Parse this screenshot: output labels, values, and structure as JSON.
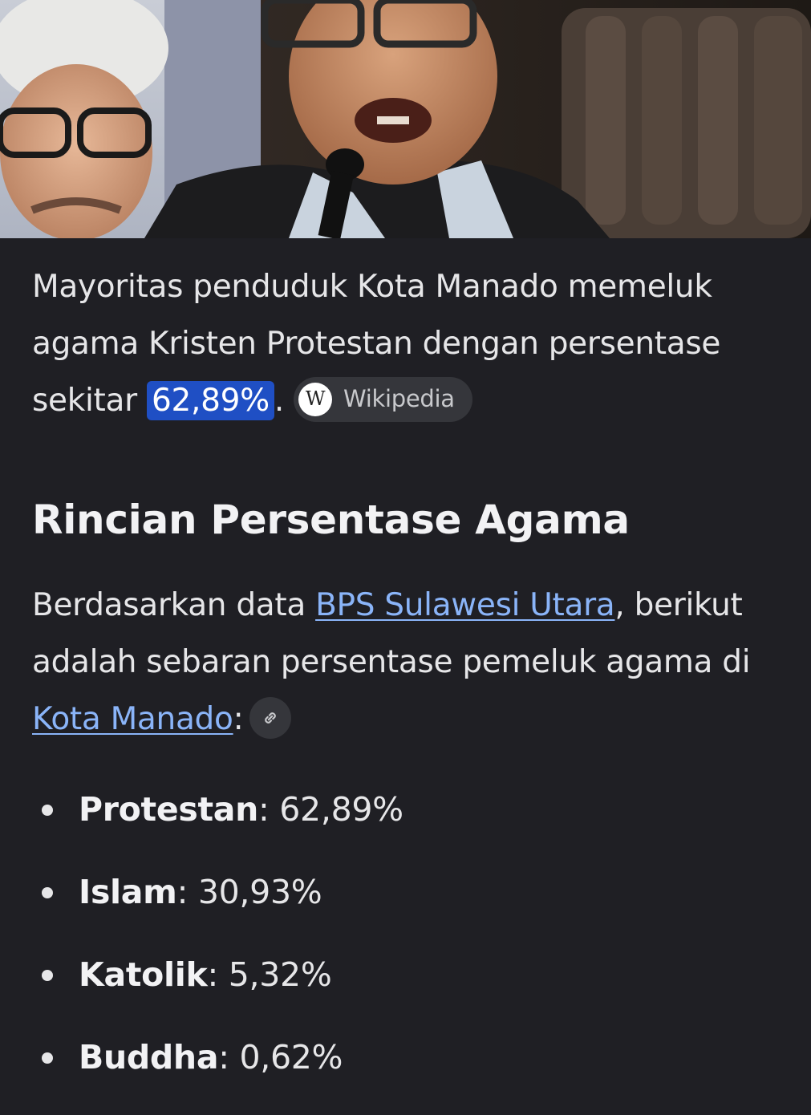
{
  "answer": {
    "text_before": "Mayoritas penduduk Kota Manado memeluk agama Kristen Protestan dengan persentase sekitar ",
    "highlight": "62,89%",
    "text_after": ".",
    "source_label": "Wikipedia",
    "source_icon": "wikipedia-logo-icon",
    "source_icon_glyph": "W"
  },
  "section": {
    "heading": "Rincian Persentase Agama",
    "intro_before": "Berdasarkan data ",
    "intro_link1": "BPS Sulawesi Utara",
    "intro_middle": ", berikut adalah sebaran persentase pemeluk agama di ",
    "intro_link2": "Kota Manado",
    "intro_after": ":",
    "link_icon": "link-icon"
  },
  "religions": [
    {
      "name": "Protestan",
      "value": ": 62,89%"
    },
    {
      "name": "Islam",
      "value": ": 30,93%"
    },
    {
      "name": "Katolik",
      "value": ": 5,32%"
    },
    {
      "name": "Buddha",
      "value": ": 0,62%"
    }
  ],
  "colors": {
    "background": "#1f1f24",
    "highlight": "#1f4fc4",
    "link": "#8ab4f8",
    "chip": "#35363b"
  }
}
